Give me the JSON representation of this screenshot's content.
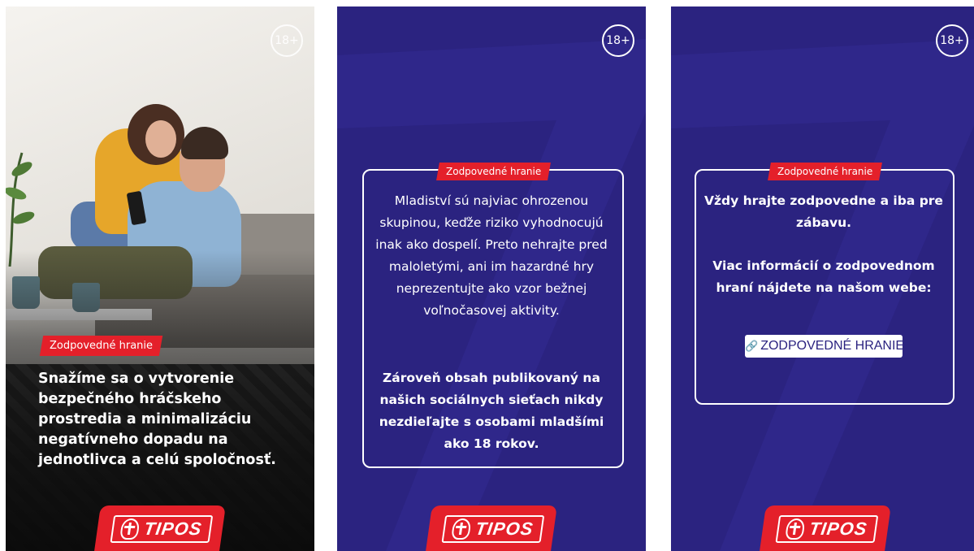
{
  "badge_age": "18+",
  "tag_label": "Zodpovedné hranie",
  "logo_text": "TIPOS",
  "panel1": {
    "text": "Snažíme sa o vytvorenie bezpečného hráčskeho prostredia a minimalizáciu negatívneho dopadu na jednotlivca a celú spoločnosť."
  },
  "panel2": {
    "text1": "Mladiství sú najviac ohrozenou skupinou, keďže riziko vyhodnocujú inak ako dospelí. Preto nehrajte pred maloletými, ani im hazardné hry neprezentujte ako vzor bežnej voľnočasovej aktivity.",
    "text2": "Zároveň obsah publikovaný na našich sociálnych sieťach nikdy nezdieľajte s osobami mladšími ako 18 rokov."
  },
  "panel3": {
    "text1": "Vždy hrajte zodpovedne a iba pre zábavu.",
    "text2": "Viac informácií o zodpovednom hraní nájdete na našom webe:",
    "link_label": "ZODPOVEDNÉ HRANIE"
  },
  "colors": {
    "brand_red": "#e4202a",
    "brand_blue": "#2b2380"
  },
  "icons": [
    "age-badge-icon",
    "link-icon",
    "tipos-logo-icon"
  ]
}
